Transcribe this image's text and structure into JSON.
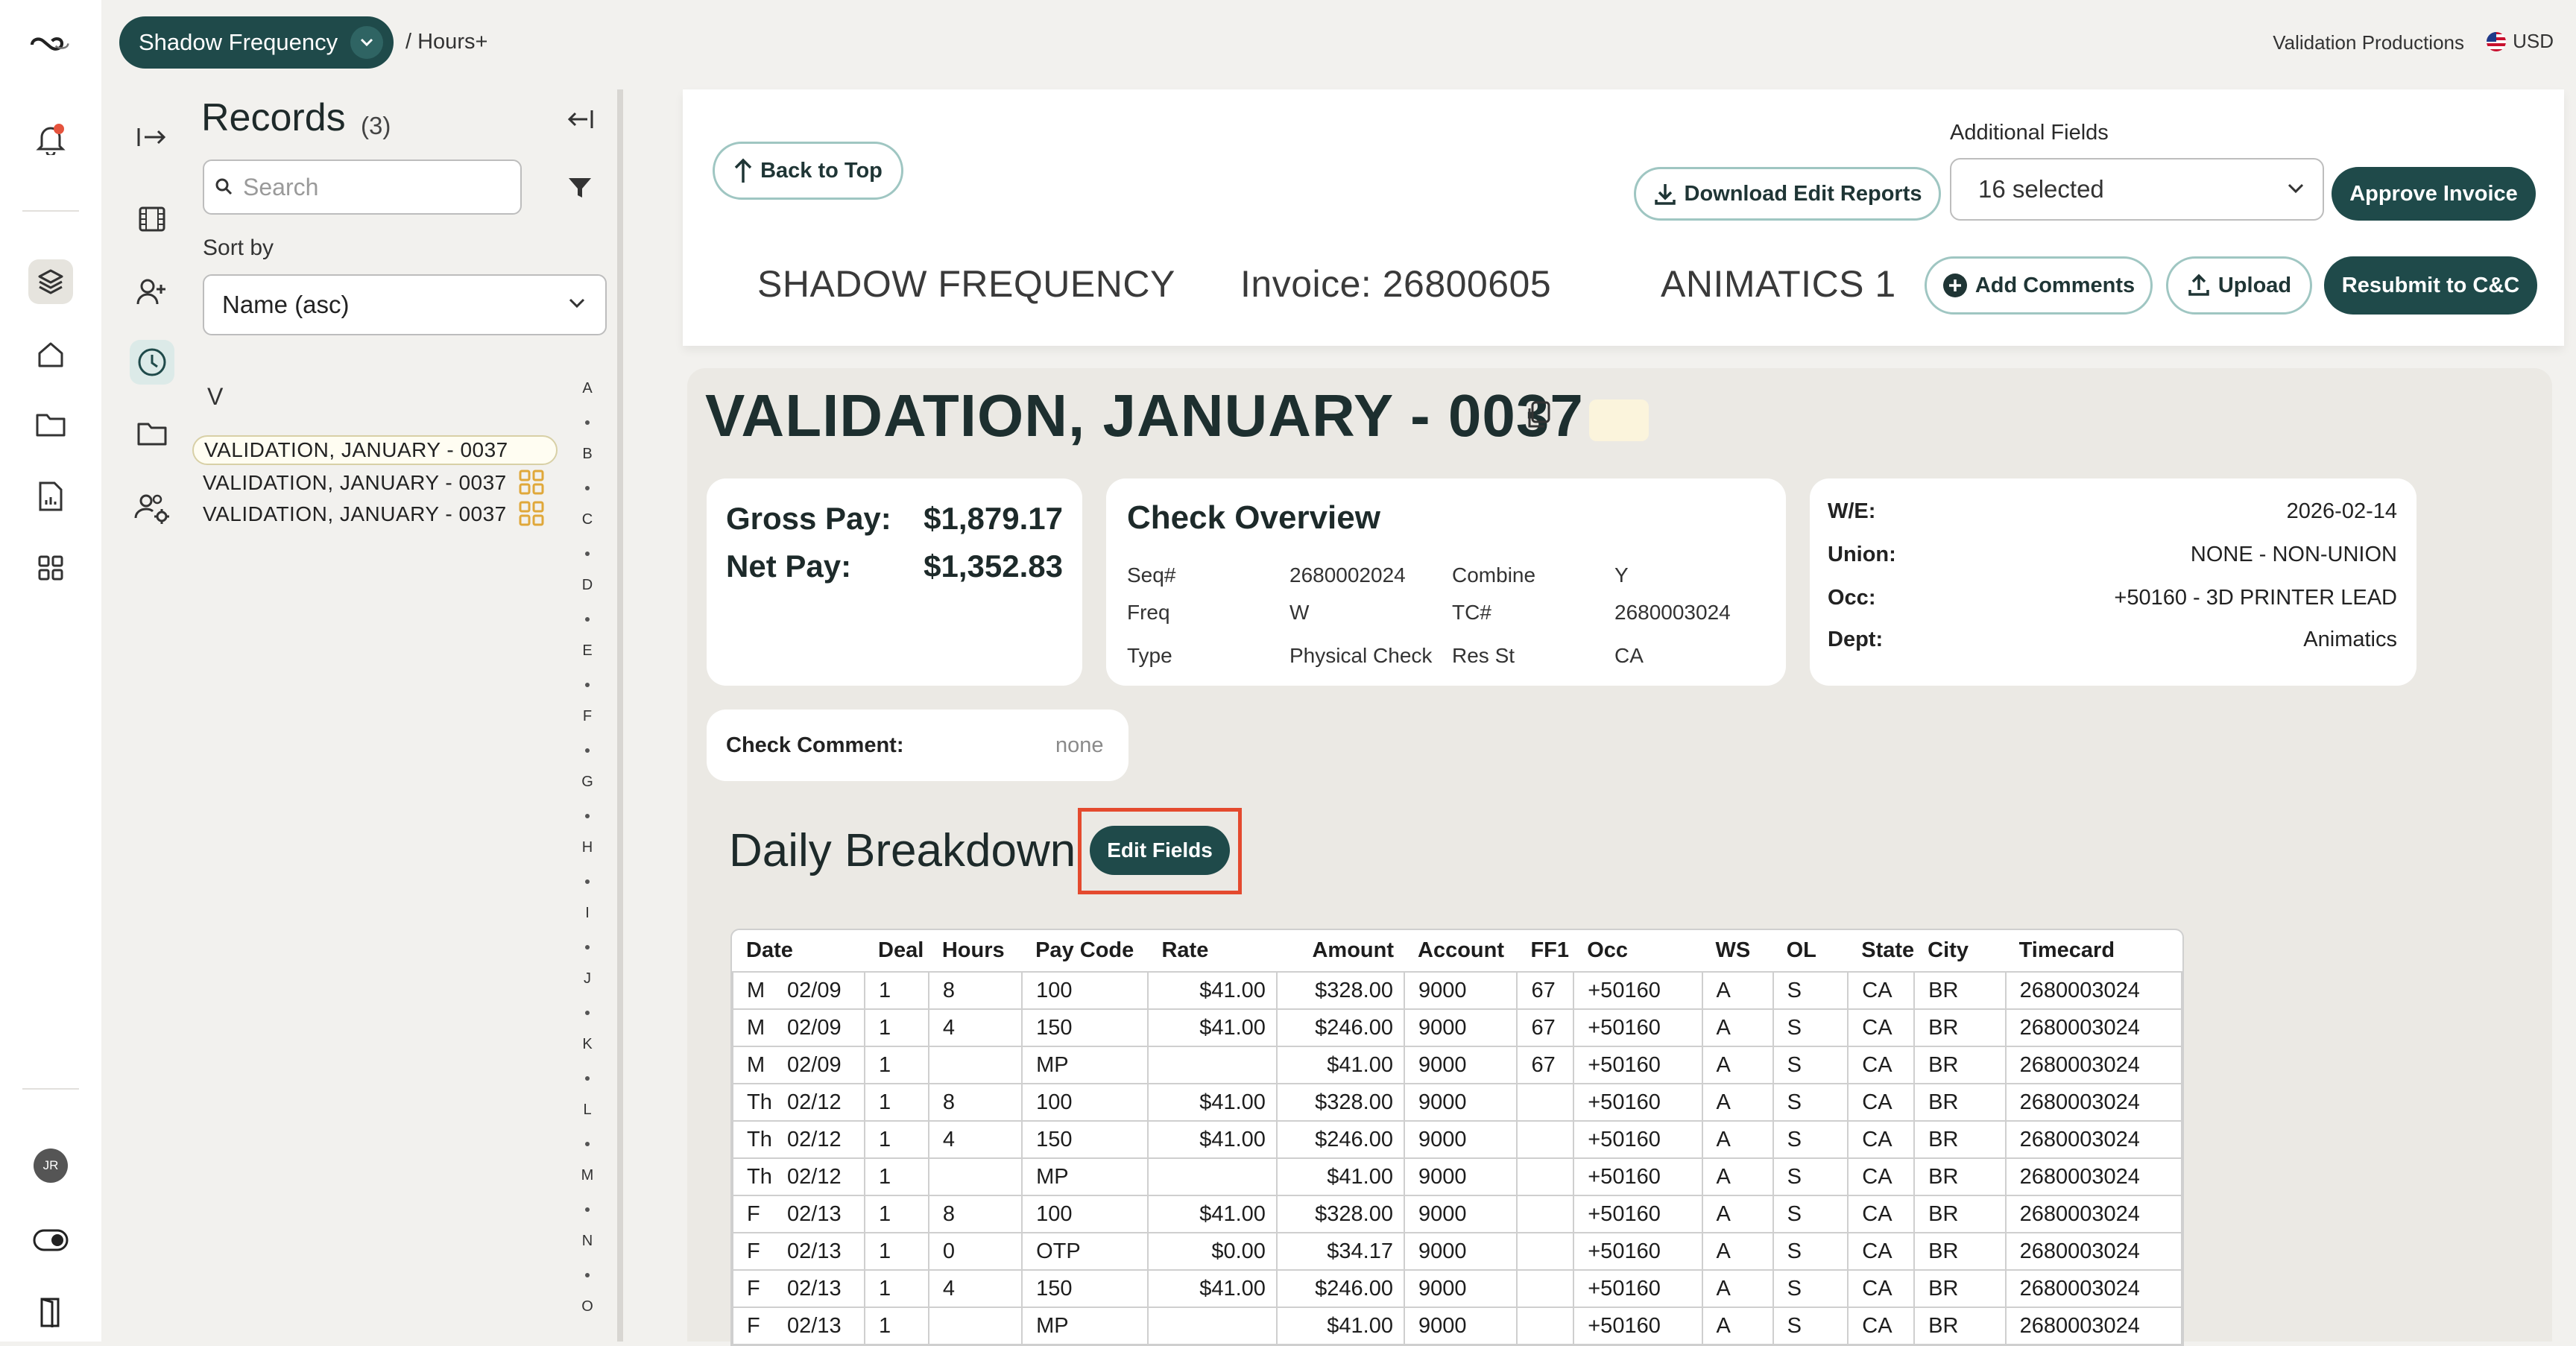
{
  "topbar": {
    "project": "Shadow Frequency",
    "breadcrumb": "/ Hours+",
    "company": "Validation Productions",
    "currency": "USD"
  },
  "rail": {
    "avatar_initials": "JR"
  },
  "records": {
    "title": "Records",
    "count": "(3)",
    "search_placeholder": "Search",
    "sort_label": "Sort by",
    "sort_value": "Name (asc)",
    "group_letter": "V",
    "items": [
      "VALIDATION, JANUARY - 0037",
      "VALIDATION, JANUARY - 0037",
      "VALIDATION, JANUARY - 0037"
    ],
    "alphabet": [
      "A",
      "B",
      "C",
      "D",
      "E",
      "F",
      "G",
      "H",
      "I",
      "J",
      "K",
      "L",
      "M",
      "N",
      "O"
    ]
  },
  "header": {
    "back_to_top": "Back to Top",
    "download_edit_reports": "Download Edit Reports",
    "additional_fields_label": "Additional Fields",
    "additional_fields_value": "16 selected",
    "approve_invoice": "Approve Invoice",
    "project_name": "SHADOW FREQUENCY",
    "invoice": "Invoice: 26800605",
    "department": "ANIMATICS 1",
    "add_comments": "Add Comments",
    "upload": "Upload",
    "resubmit": "Resubmit to C&C"
  },
  "employee": {
    "name": "VALIDATION, JANUARY - 0037"
  },
  "pay": {
    "gross_label": "Gross Pay:",
    "gross_value": "$1,879.17",
    "net_label": "Net Pay:",
    "net_value": "$1,352.83"
  },
  "check_overview": {
    "title": "Check Overview",
    "seq_label": "Seq#",
    "seq_value": "2680002024",
    "combine_label": "Combine",
    "combine_value": "Y",
    "freq_label": "Freq",
    "freq_value": "W",
    "tc_label": "TC#",
    "tc_value": "2680003024",
    "type_label": "Type",
    "type_value": "Physical Check",
    "resst_label": "Res St",
    "resst_value": "CA"
  },
  "details": {
    "we_label": "W/E:",
    "we_value": "2026-02-14",
    "union_label": "Union:",
    "union_value": "NONE - NON-UNION",
    "occ_label": "Occ:",
    "occ_value": "+50160 - 3D PRINTER LEAD",
    "dept_label": "Dept:",
    "dept_value": "Animatics"
  },
  "check_comment": {
    "label": "Check Comment:",
    "value": "none"
  },
  "daily": {
    "title": "Daily Breakdown",
    "edit_fields": "Edit Fields",
    "columns": [
      "Date",
      "Deal",
      "Hours",
      "Pay Code",
      "Rate",
      "Amount",
      "Account",
      "FF1",
      "Occ",
      "WS",
      "OL",
      "State",
      "City",
      "Timecard"
    ],
    "rows": [
      [
        "M",
        "02/09",
        "1",
        "8",
        "100",
        "$41.00",
        "$328.00",
        "9000",
        "67",
        "+50160",
        "A",
        "S",
        "CA",
        "BR",
        "2680003024"
      ],
      [
        "M",
        "02/09",
        "1",
        "4",
        "150",
        "$41.00",
        "$246.00",
        "9000",
        "67",
        "+50160",
        "A",
        "S",
        "CA",
        "BR",
        "2680003024"
      ],
      [
        "M",
        "02/09",
        "1",
        "",
        "MP",
        "",
        "$41.00",
        "9000",
        "67",
        "+50160",
        "A",
        "S",
        "CA",
        "BR",
        "2680003024"
      ],
      [
        "Th",
        "02/12",
        "1",
        "8",
        "100",
        "$41.00",
        "$328.00",
        "9000",
        "",
        "+50160",
        "A",
        "S",
        "CA",
        "BR",
        "2680003024"
      ],
      [
        "Th",
        "02/12",
        "1",
        "4",
        "150",
        "$41.00",
        "$246.00",
        "9000",
        "",
        "+50160",
        "A",
        "S",
        "CA",
        "BR",
        "2680003024"
      ],
      [
        "Th",
        "02/12",
        "1",
        "",
        "MP",
        "",
        "$41.00",
        "9000",
        "",
        "+50160",
        "A",
        "S",
        "CA",
        "BR",
        "2680003024"
      ],
      [
        "F",
        "02/13",
        "1",
        "8",
        "100",
        "$41.00",
        "$328.00",
        "9000",
        "",
        "+50160",
        "A",
        "S",
        "CA",
        "BR",
        "2680003024"
      ],
      [
        "F",
        "02/13",
        "1",
        "0",
        "OTP",
        "$0.00",
        "$34.17",
        "9000",
        "",
        "+50160",
        "A",
        "S",
        "CA",
        "BR",
        "2680003024"
      ],
      [
        "F",
        "02/13",
        "1",
        "4",
        "150",
        "$41.00",
        "$246.00",
        "9000",
        "",
        "+50160",
        "A",
        "S",
        "CA",
        "BR",
        "2680003024"
      ],
      [
        "F",
        "02/13",
        "1",
        "",
        "MP",
        "",
        "$41.00",
        "9000",
        "",
        "+50160",
        "A",
        "S",
        "CA",
        "BR",
        "2680003024"
      ]
    ]
  },
  "colors": {
    "brand": "#1f4a4a",
    "outline": "#9fc6c2",
    "highlight": "#e44a2e",
    "notification": "#e5533d"
  }
}
